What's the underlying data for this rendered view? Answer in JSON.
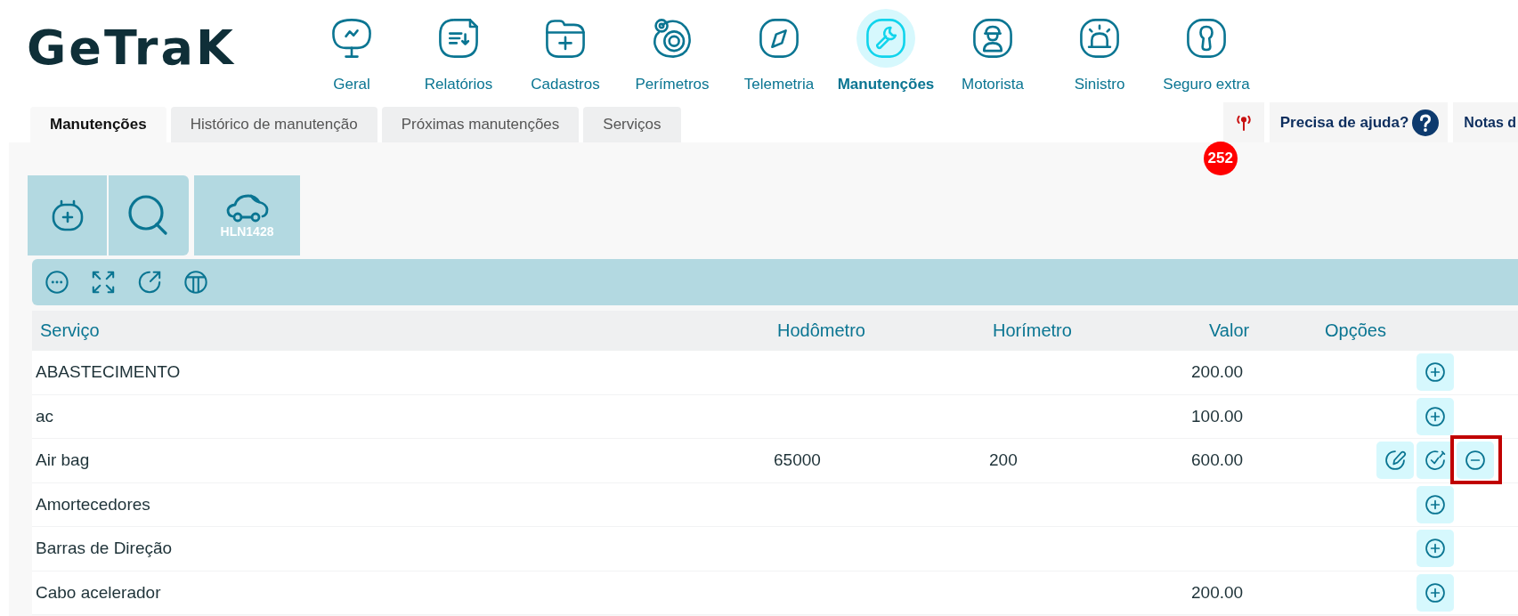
{
  "logo": {
    "text": "GeTraK"
  },
  "nav": [
    {
      "label": "Geral",
      "selected": false
    },
    {
      "label": "Relatórios",
      "selected": false
    },
    {
      "label": "Cadastros",
      "selected": false
    },
    {
      "label": "Perímetros",
      "selected": false
    },
    {
      "label": "Telemetria",
      "selected": false
    },
    {
      "label": "Manutenções",
      "selected": true
    },
    {
      "label": "Motorista",
      "selected": false
    },
    {
      "label": "Sinistro",
      "selected": false
    },
    {
      "label": "Seguro extra",
      "selected": false
    }
  ],
  "tabs": [
    {
      "label": "Manutenções",
      "selected": true
    },
    {
      "label": "Histórico de manutenção",
      "selected": false
    },
    {
      "label": "Próximas manutenções",
      "selected": false
    },
    {
      "label": "Serviços",
      "selected": false
    }
  ],
  "alerts": {
    "count": "252"
  },
  "help": {
    "label": "Precisa de ajuda?"
  },
  "notes": {
    "label": "Notas d"
  },
  "vehicle": {
    "plate": "HLN1428"
  },
  "table": {
    "columns": [
      "Serviço",
      "Hodômetro",
      "Horímetro",
      "Valor",
      "Opções"
    ],
    "rows": [
      {
        "cells": [
          "ABASTECIMENTO",
          "",
          "",
          "200.00"
        ],
        "actions": [
          {
            "kind": "add",
            "highlighted": false
          }
        ]
      },
      {
        "cells": [
          "ac",
          "",
          "",
          "100.00"
        ],
        "actions": [
          {
            "kind": "add",
            "highlighted": false
          }
        ]
      },
      {
        "cells": [
          "Air bag",
          "65000",
          "200",
          "600.00"
        ],
        "actions": [
          {
            "kind": "edit",
            "highlighted": false
          },
          {
            "kind": "done",
            "highlighted": false
          },
          {
            "kind": "remove",
            "highlighted": true
          }
        ]
      },
      {
        "cells": [
          "Amortecedores",
          "",
          "",
          ""
        ],
        "actions": [
          {
            "kind": "add",
            "highlighted": false
          }
        ]
      },
      {
        "cells": [
          "Barras de Direção",
          "",
          "",
          ""
        ],
        "actions": [
          {
            "kind": "add",
            "highlighted": false
          }
        ]
      },
      {
        "cells": [
          "Cabo acelerador",
          "",
          "",
          "200.00"
        ],
        "actions": [
          {
            "kind": "add",
            "highlighted": false
          }
        ]
      }
    ]
  }
}
